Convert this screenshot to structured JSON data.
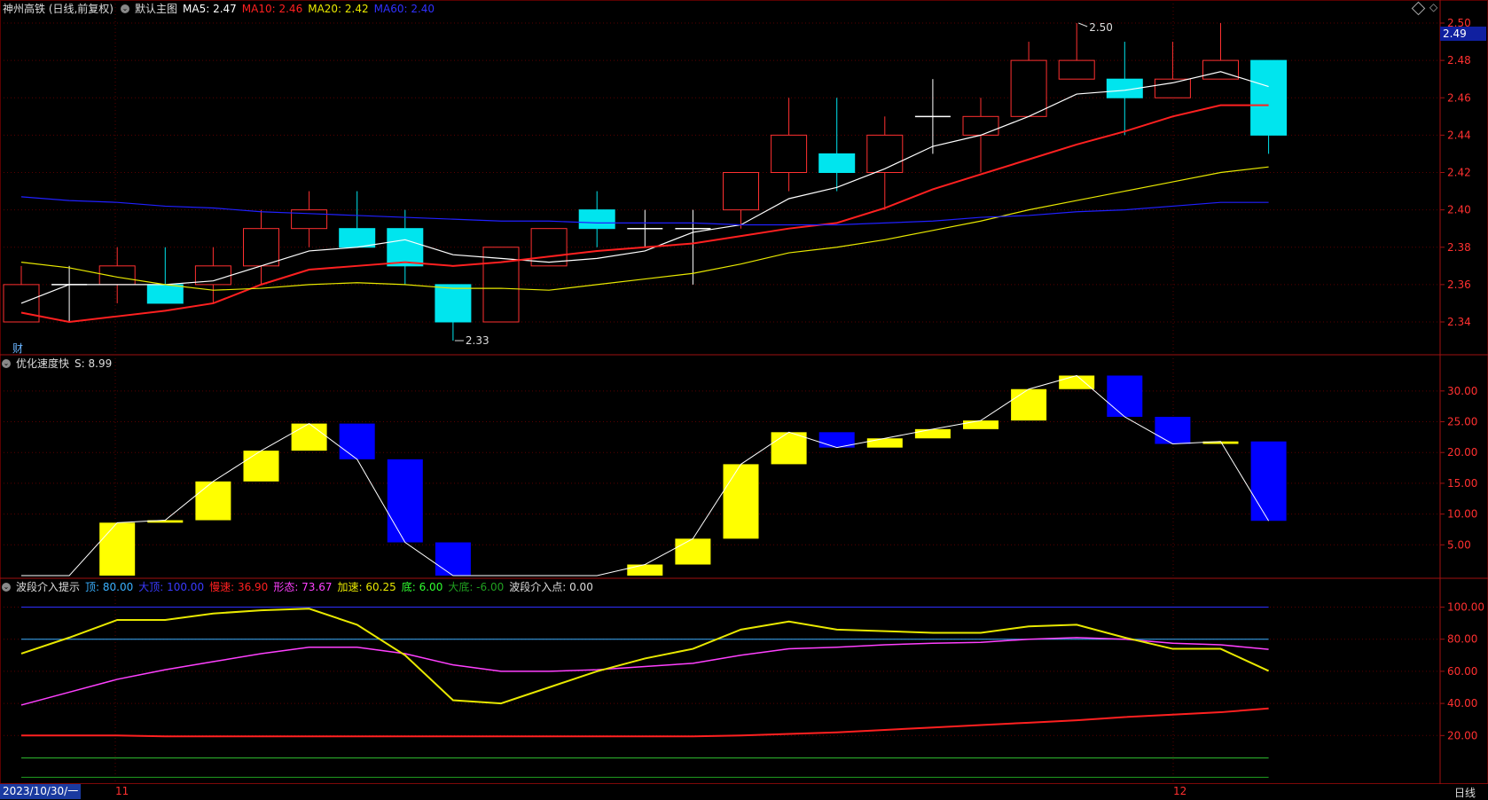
{
  "colors": {
    "bg": "#000000",
    "grid": "#5a0000",
    "up": "#ff3030",
    "down": "#00e5ee",
    "ma5": "#ffffff",
    "ma10": "#ff2020",
    "ma20": "#e8e800",
    "ma60": "#2020ff",
    "hist_up": "#ffff00",
    "hist_down": "#0000ff",
    "axis_text": "#ff3030"
  },
  "main_header": {
    "title": "神州高铁 (日线,前复权)",
    "mode": "默认主图",
    "ma5": "MA5: 2.47",
    "ma10": "MA10: 2.46",
    "ma20": "MA20: 2.42",
    "ma60": "MA60: 2.40"
  },
  "fin_label": "财",
  "price_badge": "2.49",
  "high_label": "2.50",
  "low_label": "2.33",
  "sub1_header": {
    "name": "优化速度快",
    "value": "S: 8.99"
  },
  "sub2_header": {
    "name": "波段介入提示",
    "top": "顶: 80.00",
    "big_top": "大顶: 100.00",
    "slow": "慢速: 36.90",
    "shape": "形态: 73.67",
    "accel": "加速: 60.25",
    "bottom": "底: 6.00",
    "big_bottom": "大底: -6.00",
    "entry": "波段介入点: 0.00"
  },
  "bottom_bar": {
    "date": "2023/10/30/一",
    "month1": "11",
    "month2": "12",
    "period": "日线"
  },
  "chart_data": [
    {
      "type": "candlestick",
      "title": "神州高铁 (日线,前复权)",
      "ylim": [
        2.33,
        2.51
      ],
      "yticks": [
        "2.34",
        "2.36",
        "2.38",
        "2.40",
        "2.42",
        "2.44",
        "2.46",
        "2.48",
        "2.50"
      ],
      "candles": [
        {
          "o": 2.34,
          "c": 2.36,
          "h": 2.37,
          "l": 2.34
        },
        {
          "o": 2.36,
          "c": 2.36,
          "h": 2.37,
          "l": 2.34
        },
        {
          "o": 2.36,
          "c": 2.37,
          "h": 2.38,
          "l": 2.35
        },
        {
          "o": 2.36,
          "c": 2.35,
          "h": 2.38,
          "l": 2.35
        },
        {
          "o": 2.36,
          "c": 2.37,
          "h": 2.38,
          "l": 2.35
        },
        {
          "o": 2.37,
          "c": 2.39,
          "h": 2.4,
          "l": 2.36
        },
        {
          "o": 2.39,
          "c": 2.4,
          "h": 2.41,
          "l": 2.38
        },
        {
          "o": 2.39,
          "c": 2.38,
          "h": 2.41,
          "l": 2.38
        },
        {
          "o": 2.39,
          "c": 2.37,
          "h": 2.4,
          "l": 2.36
        },
        {
          "o": 2.36,
          "c": 2.34,
          "h": 2.36,
          "l": 2.33
        },
        {
          "o": 2.34,
          "c": 2.38,
          "h": 2.38,
          "l": 2.34
        },
        {
          "o": 2.37,
          "c": 2.39,
          "h": 2.39,
          "l": 2.37
        },
        {
          "o": 2.4,
          "c": 2.39,
          "h": 2.41,
          "l": 2.38
        },
        {
          "o": 2.39,
          "c": 2.39,
          "h": 2.4,
          "l": 2.38
        },
        {
          "o": 2.39,
          "c": 2.39,
          "h": 2.4,
          "l": 2.36
        },
        {
          "o": 2.4,
          "c": 2.42,
          "h": 2.42,
          "l": 2.39
        },
        {
          "o": 2.42,
          "c": 2.44,
          "h": 2.46,
          "l": 2.41
        },
        {
          "o": 2.43,
          "c": 2.42,
          "h": 2.46,
          "l": 2.41
        },
        {
          "o": 2.42,
          "c": 2.44,
          "h": 2.45,
          "l": 2.4
        },
        {
          "o": 2.45,
          "c": 2.45,
          "h": 2.47,
          "l": 2.43
        },
        {
          "o": 2.44,
          "c": 2.45,
          "h": 2.46,
          "l": 2.42
        },
        {
          "o": 2.45,
          "c": 2.48,
          "h": 2.49,
          "l": 2.45
        },
        {
          "o": 2.47,
          "c": 2.48,
          "h": 2.5,
          "l": 2.47
        },
        {
          "o": 2.47,
          "c": 2.46,
          "h": 2.49,
          "l": 2.44
        },
        {
          "o": 2.46,
          "c": 2.47,
          "h": 2.49,
          "l": 2.46
        },
        {
          "o": 2.47,
          "c": 2.48,
          "h": 2.5,
          "l": 2.47
        },
        {
          "o": 2.48,
          "c": 2.44,
          "h": 2.48,
          "l": 2.43
        }
      ],
      "series": [
        {
          "name": "MA5",
          "values": [
            2.35,
            2.36,
            2.36,
            2.36,
            2.362,
            2.37,
            2.378,
            2.38,
            2.384,
            2.376,
            2.374,
            2.372,
            2.374,
            2.378,
            2.388,
            2.392,
            2.406,
            2.412,
            2.422,
            2.434,
            2.44,
            2.45,
            2.462,
            2.464,
            2.468,
            2.474,
            2.466
          ]
        },
        {
          "name": "MA10",
          "values": [
            2.345,
            2.34,
            2.343,
            2.346,
            2.35,
            2.36,
            2.368,
            2.37,
            2.372,
            2.37,
            2.372,
            2.375,
            2.378,
            2.38,
            2.382,
            2.386,
            2.39,
            2.393,
            2.401,
            2.411,
            2.419,
            2.427,
            2.435,
            2.442,
            2.45,
            2.456,
            2.456
          ]
        },
        {
          "name": "MA20",
          "values": [
            2.372,
            2.369,
            2.364,
            2.36,
            2.357,
            2.358,
            2.36,
            2.361,
            2.36,
            2.358,
            2.358,
            2.357,
            2.36,
            2.363,
            2.366,
            2.371,
            2.377,
            2.38,
            2.384,
            2.389,
            2.394,
            2.4,
            2.405,
            2.41,
            2.415,
            2.42,
            2.423
          ]
        },
        {
          "name": "MA60",
          "values": [
            2.407,
            2.405,
            2.404,
            2.402,
            2.401,
            2.399,
            2.398,
            2.397,
            2.396,
            2.395,
            2.394,
            2.394,
            2.393,
            2.393,
            2.393,
            2.392,
            2.392,
            2.392,
            2.393,
            2.394,
            2.396,
            2.397,
            2.399,
            2.4,
            2.402,
            2.404,
            2.404
          ]
        }
      ]
    },
    {
      "type": "bar",
      "title": "优化速度快",
      "ylim": [
        0,
        33
      ],
      "yticks": [
        "5.00",
        "10.00",
        "15.00",
        "20.00",
        "25.00",
        "30.00"
      ],
      "bars": [
        {
          "from": 0,
          "to": 0
        },
        {
          "from": 0,
          "to": 0
        },
        {
          "from": 0,
          "to": 8.6
        },
        {
          "from": 8.6,
          "to": 9.0
        },
        {
          "from": 9.0,
          "to": 15.3
        },
        {
          "from": 15.3,
          "to": 20.3
        },
        {
          "from": 20.3,
          "to": 24.7
        },
        {
          "from": 24.7,
          "to": 18.9
        },
        {
          "from": 18.9,
          "to": 5.4
        },
        {
          "from": 5.4,
          "to": 0
        },
        {
          "from": 0,
          "to": 0
        },
        {
          "from": 0,
          "to": 0
        },
        {
          "from": 0,
          "to": 0
        },
        {
          "from": 0,
          "to": 1.8
        },
        {
          "from": 1.8,
          "to": 6.0
        },
        {
          "from": 6.0,
          "to": 18.1
        },
        {
          "from": 18.1,
          "to": 23.3
        },
        {
          "from": 23.3,
          "to": 20.8
        },
        {
          "from": 20.8,
          "to": 22.3
        },
        {
          "from": 22.3,
          "to": 23.8
        },
        {
          "from": 23.8,
          "to": 25.2
        },
        {
          "from": 25.2,
          "to": 30.3
        },
        {
          "from": 30.3,
          "to": 32.5
        },
        {
          "from": 32.5,
          "to": 25.8
        },
        {
          "from": 25.8,
          "to": 21.4
        },
        {
          "from": 21.4,
          "to": 21.8
        },
        {
          "from": 21.8,
          "to": 8.9
        }
      ]
    },
    {
      "type": "line",
      "title": "波段介入提示",
      "ylim": [
        -8,
        108
      ],
      "yticks": [
        "20.00",
        "40.00",
        "60.00",
        "80.00",
        "100.00"
      ],
      "series": [
        {
          "name": "顶",
          "values": [
            80,
            80,
            80,
            80,
            80,
            80,
            80,
            80,
            80,
            80,
            80,
            80,
            80,
            80,
            80,
            80,
            80,
            80,
            80,
            80,
            80,
            80,
            80,
            80,
            80,
            80,
            80
          ]
        },
        {
          "name": "大顶",
          "values": [
            100,
            100,
            100,
            100,
            100,
            100,
            100,
            100,
            100,
            100,
            100,
            100,
            100,
            100,
            100,
            100,
            100,
            100,
            100,
            100,
            100,
            100,
            100,
            100,
            100,
            100,
            100
          ]
        },
        {
          "name": "慢速",
          "values": [
            20,
            20,
            20,
            19.5,
            19.5,
            19.5,
            19.5,
            19.5,
            19.5,
            19.5,
            19.5,
            19.5,
            19.5,
            19.5,
            19.5,
            20,
            21,
            22,
            23.5,
            25,
            26.5,
            28,
            29.5,
            31.5,
            33,
            34.5,
            36.9
          ]
        },
        {
          "name": "形态",
          "values": [
            39,
            47,
            55,
            61,
            66,
            71,
            75,
            75,
            71,
            64,
            60,
            60,
            61,
            63,
            65,
            70,
            74,
            75,
            76.5,
            77.5,
            78,
            80,
            81,
            80,
            77.5,
            76.5,
            73.67
          ]
        },
        {
          "name": "加速",
          "values": [
            71,
            81,
            92,
            92,
            96,
            98,
            99,
            89,
            70,
            42,
            40,
            50,
            60,
            68,
            74,
            86,
            91,
            86,
            85,
            84,
            84,
            88,
            89,
            81,
            74,
            74,
            60.25
          ]
        },
        {
          "name": "底",
          "values": [
            6,
            6,
            6,
            6,
            6,
            6,
            6,
            6,
            6,
            6,
            6,
            6,
            6,
            6,
            6,
            6,
            6,
            6,
            6,
            6,
            6,
            6,
            6,
            6,
            6,
            6,
            6
          ]
        },
        {
          "name": "大底",
          "values": [
            -6,
            -6,
            -6,
            -6,
            -6,
            -6,
            -6,
            -6,
            -6,
            -6,
            -6,
            -6,
            -6,
            -6,
            -6,
            -6,
            -6,
            -6,
            -6,
            -6,
            -6,
            -6,
            -6,
            -6,
            -6,
            -6,
            -6
          ]
        },
        {
          "name": "波段介入点",
          "values": [
            0,
            0,
            0,
            0,
            0,
            0,
            0,
            0,
            0,
            0,
            0,
            0,
            0,
            0,
            0,
            0,
            0,
            0,
            0,
            0,
            0,
            0,
            0,
            0,
            0,
            0,
            0
          ]
        }
      ]
    }
  ]
}
